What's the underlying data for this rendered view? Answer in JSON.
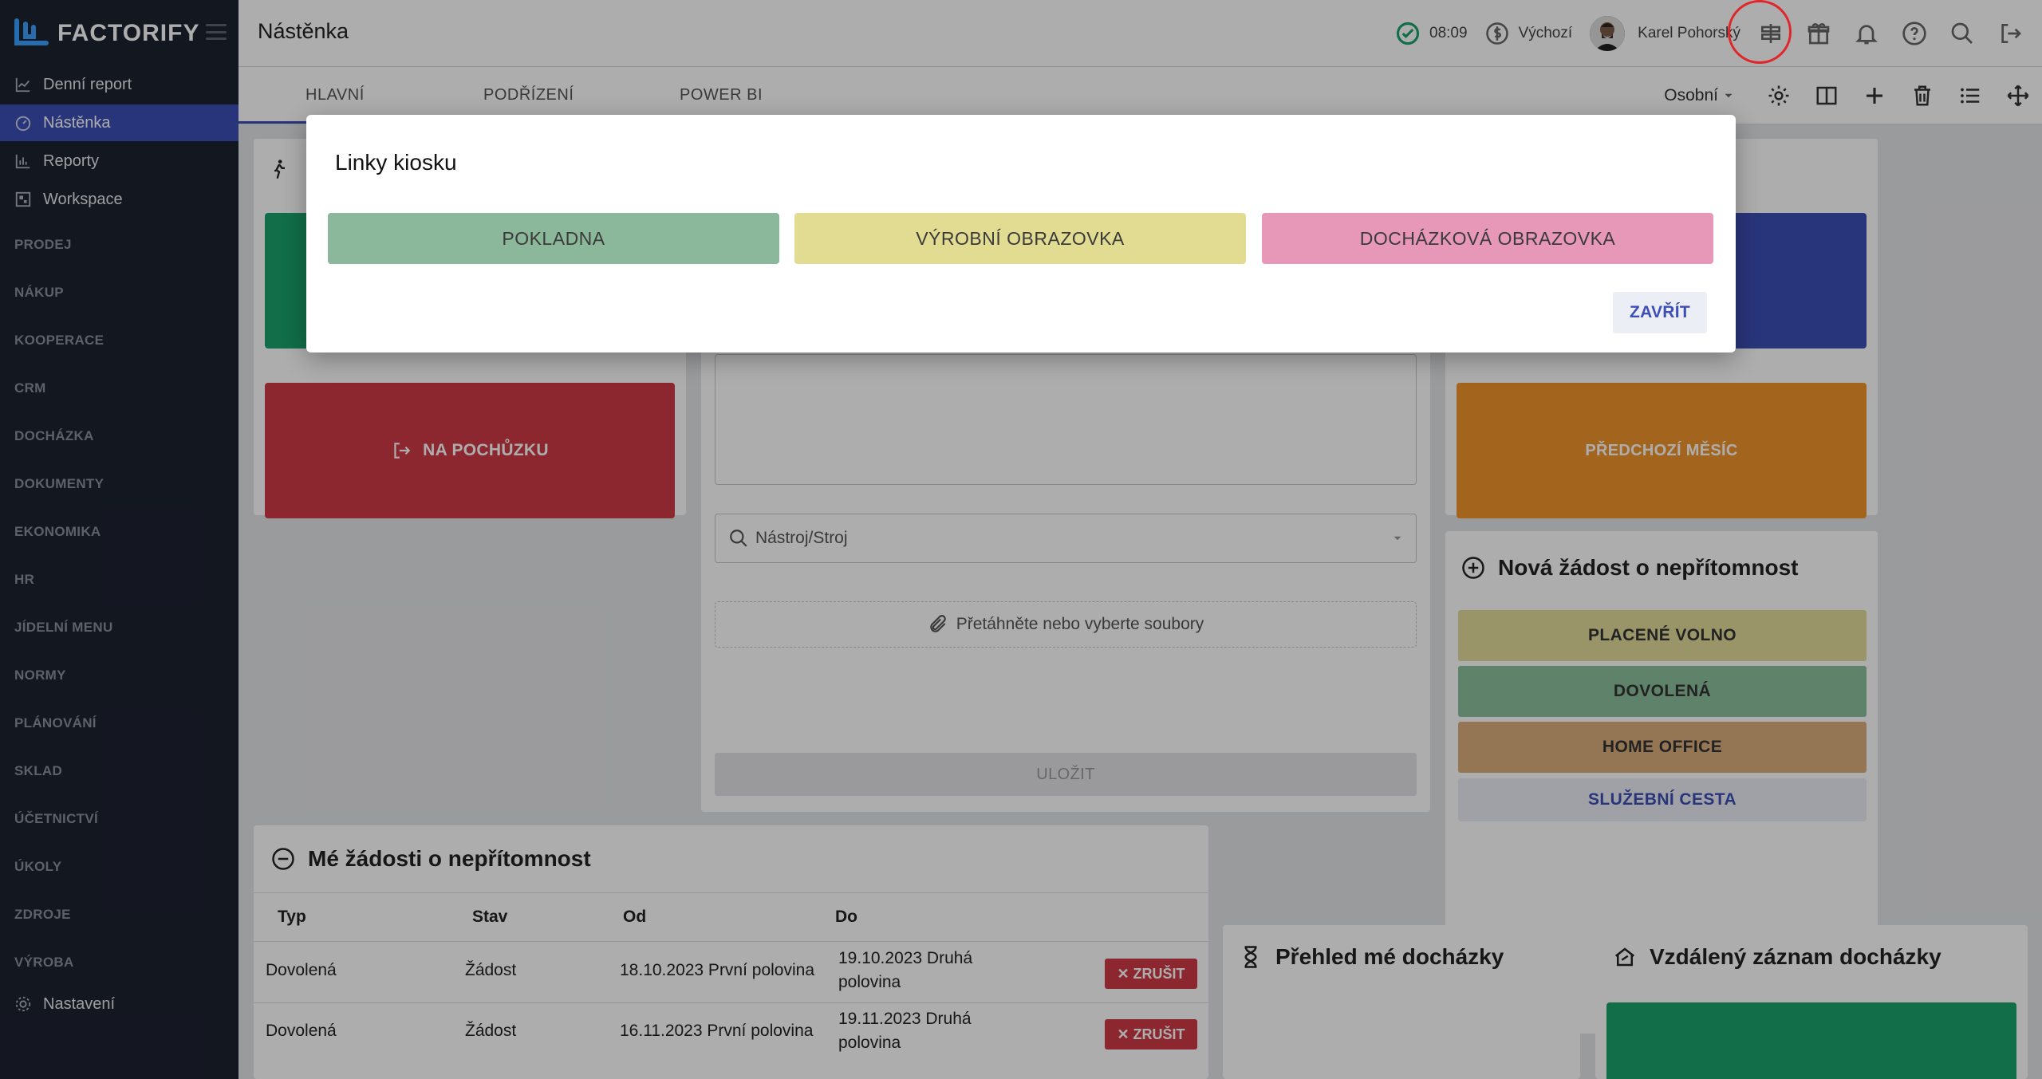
{
  "app": {
    "logo_text": "FACTORIFY",
    "page_title": "Nástěnka"
  },
  "sidebar": {
    "items": [
      {
        "label": "Denní report",
        "icon": "chart-line-icon"
      },
      {
        "label": "Nástěnka",
        "icon": "dashboard-icon",
        "active": true
      },
      {
        "label": "Reporty",
        "icon": "bar-chart-icon"
      },
      {
        "label": "Workspace",
        "icon": "workspace-icon"
      }
    ],
    "sections": [
      "PRODEJ",
      "NÁKUP",
      "KOOPERACE",
      "CRM",
      "DOCHÁZKA",
      "DOKUMENTY",
      "EKONOMIKA",
      "HR",
      "JÍDELNÍ MENU",
      "NORMY",
      "PLÁNOVÁNÍ",
      "SKLAD",
      "ÚČETNICTVÍ",
      "ÚKOLY",
      "ZDROJE",
      "VÝROBA"
    ],
    "settings_label": "Nastavení"
  },
  "header": {
    "time": "08:09",
    "currency_mode": "Výchozí",
    "user_name": "Karel Pohorský"
  },
  "tabs": [
    {
      "label": "HLAVNÍ"
    },
    {
      "label": "PODŘÍZENÍ"
    },
    {
      "label": "POWER BI"
    }
  ],
  "toolbar": {
    "view_select": "Osobní"
  },
  "dashboard": {
    "pochuzka_label": "NA POCHŮZKU",
    "prev_month_label": "PŘEDCHOZÍ MĚSÍC",
    "tool_placeholder": "Nástroj/Stroj",
    "upload_label": "Přetáhněte nebo vyberte soubory",
    "save_label": "ULOŽIT",
    "absence_request": {
      "title": "Nová žádost o nepřítomnost",
      "buttons": [
        {
          "label": "PLACENÉ VOLNO",
          "color": "#e2dc9a"
        },
        {
          "label": "DOVOLENÁ",
          "color": "#8bc29d"
        },
        {
          "label": "HOME OFFICE",
          "color": "#dcae7c"
        },
        {
          "label": "SLUŽEBNÍ CESTA",
          "color": "#eceef6"
        }
      ]
    },
    "my_requests": {
      "title": "Mé žádosti o nepřítomnost",
      "columns": [
        "Typ",
        "Stav",
        "Od",
        "Do"
      ],
      "rows": [
        {
          "typ": "Dovolená",
          "stav": "Žádost",
          "od": "18.10.2023 První polovina",
          "do1": "19.10.2023 Druhá",
          "do2": "polovina",
          "action": "✕ ZRUŠIT"
        },
        {
          "typ": "Dovolená",
          "stav": "Žádost",
          "od": "16.11.2023 První polovina",
          "do1": "19.11.2023 Druhá",
          "do2": "polovina",
          "action": "✕ ZRUŠIT"
        }
      ]
    },
    "attendance_overview_title": "Přehled mé docházky",
    "remote_attendance_title": "Vzdálený záznam docházky"
  },
  "modal": {
    "title": "Linky kiosku",
    "buttons": [
      {
        "label": "POKLADNA",
        "color": "#8bb89b"
      },
      {
        "label": "VÝROBNÍ OBRAZOVKA",
        "color": "#e2dc92"
      },
      {
        "label": "DOCHÁZKOVÁ OBRAZOVKA",
        "color": "#e797b8"
      }
    ],
    "close_label": "ZAVŘÍT"
  },
  "colors": {
    "accent": "#3d4fb6",
    "sidebar_bg": "#1d2230",
    "danger": "#d03a46",
    "success": "#1aa36a",
    "warning": "#f0962b",
    "highlight_ring": "#e0252b"
  }
}
